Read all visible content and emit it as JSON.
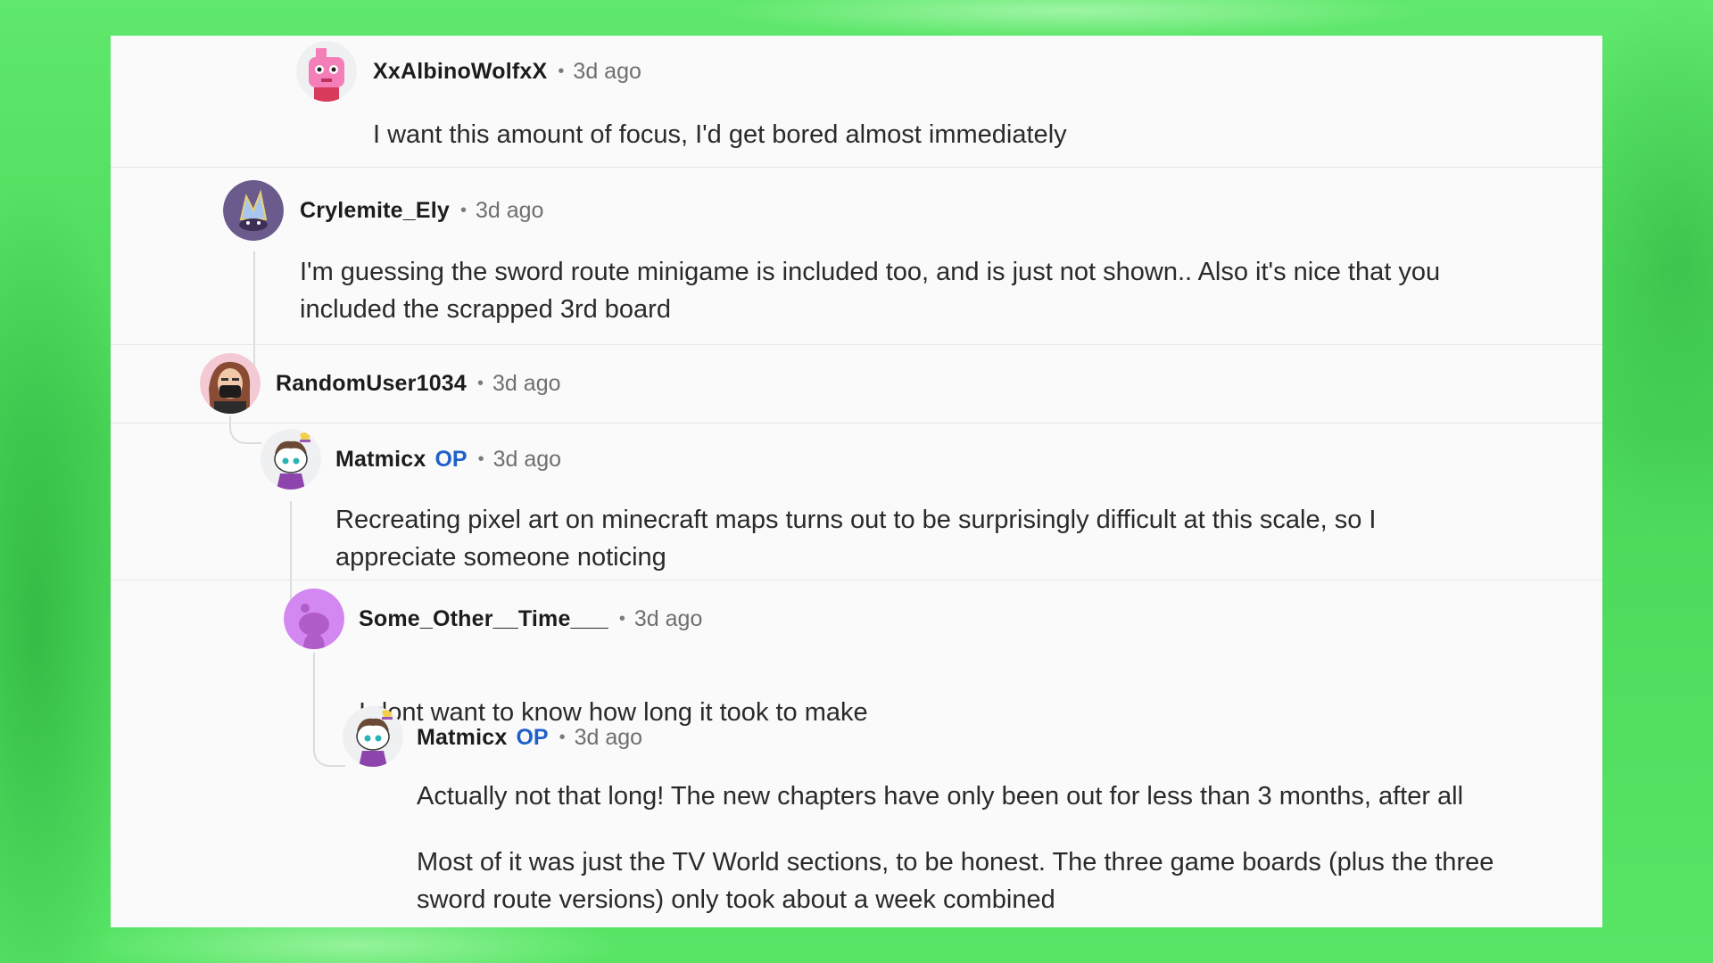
{
  "comments": [
    {
      "user": "XxAlbinoWolfxX",
      "time": "3d ago",
      "text": "I want this amount of focus, I'd get bored almost immediately",
      "avatar": "pink-robot-avatar-icon"
    },
    {
      "user": "Crylemite_Ely",
      "time": "3d ago",
      "text_lines": [
        "I'm guessing the sword route minigame is included too, and is just not shown.. Also it's nice that you",
        "included the scrapped 3rd board"
      ],
      "avatar": "purple-crystal-avatar-icon"
    },
    {
      "user": "RandomUser1034",
      "time": "3d ago",
      "avatar": "masked-person-avatar-icon"
    },
    {
      "user": "Matmicx",
      "badge": "OP",
      "time": "3d ago",
      "text_lines": [
        "Recreating pixel art on minecraft maps turns out to be surprisingly difficult at this scale, so I",
        "appreciate someone noticing"
      ],
      "avatar": "snoo-avatar-icon"
    },
    {
      "user": "Some_Other__Time___",
      "time": "3d ago",
      "text": "I dont want to know how long it took to make",
      "avatar": "default-snoo-avatar-icon"
    },
    {
      "user": "Matmicx",
      "badge": "OP",
      "time": "3d ago",
      "paragraph1": "Actually not that long! The new chapters have only been out for less than 3 months, after all",
      "paragraph2_lines": [
        "Most of it was just the TV World sections, to be honest. The three game boards (plus the three",
        "sword route versions) only took about a week combined"
      ],
      "avatar": "snoo-avatar-icon"
    }
  ],
  "colors": {
    "background": "#4bd85a",
    "card": "#fafafa",
    "op": "#2060c8"
  }
}
